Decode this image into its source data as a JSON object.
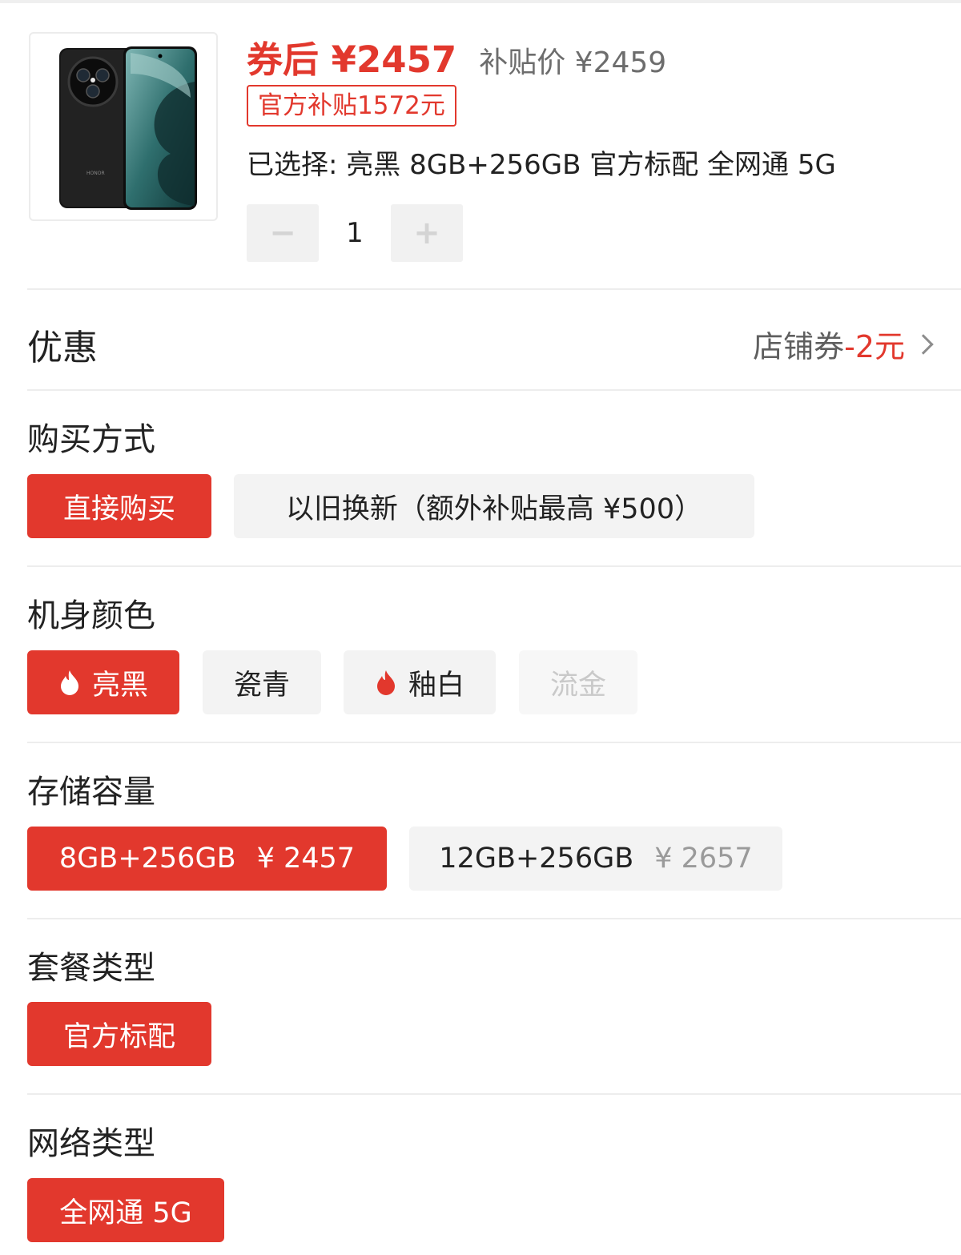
{
  "product": {
    "image_alt": "HONOR",
    "price_after_coupon": "券后 ¥2457",
    "subsidy_price": "补贴价 ¥2459",
    "subsidy_badge": "官方补贴1572元",
    "selected": "已选择: 亮黑 8GB+256GB 官方标配 全网通 5G",
    "quantity": "1",
    "minus_symbol": "−",
    "plus_symbol": "+"
  },
  "coupon": {
    "title": "优惠",
    "label": "店铺券",
    "amount": "-2元"
  },
  "purchase_method": {
    "title": "购买方式",
    "options": [
      "直接购买",
      "以旧换新（额外补贴最高 ¥500）"
    ]
  },
  "color": {
    "title": "机身颜色",
    "options": [
      "亮黑",
      "瓷青",
      "釉白",
      "流金"
    ]
  },
  "storage": {
    "title": "存储容量",
    "options": [
      {
        "name": "8GB+256GB",
        "price": "¥ 2457"
      },
      {
        "name": "12GB+256GB",
        "price": "¥ 2657"
      }
    ]
  },
  "package": {
    "title": "套餐类型",
    "options": [
      "官方标配"
    ]
  },
  "network": {
    "title": "网络类型",
    "options": [
      "全网通 5G"
    ]
  },
  "colors": {
    "accent": "#e2382d",
    "option_bg": "#f3f3f3",
    "divider": "#ededed"
  },
  "icons": [
    "flame-icon",
    "chevron-right-icon",
    "minus-icon",
    "plus-icon"
  ]
}
